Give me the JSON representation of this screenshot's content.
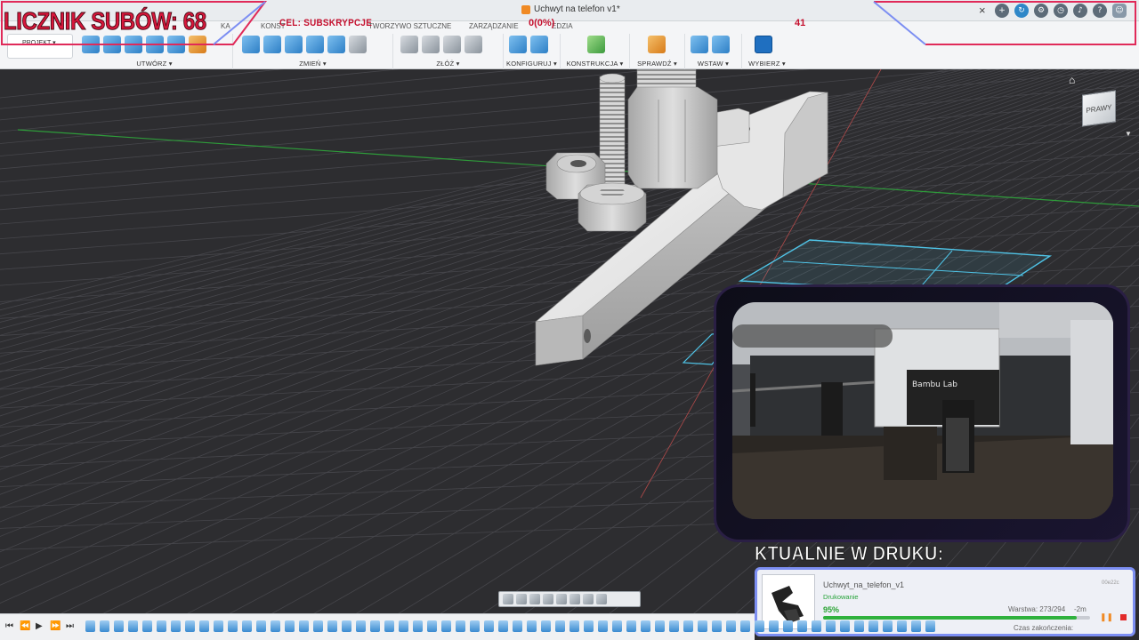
{
  "window": {
    "document_title": "Uchwyt na telefon v1*",
    "close_glyph": "×",
    "toolbar_icons": [
      "add-icon",
      "cloud-sync-icon",
      "extensions-icon",
      "clock-icon",
      "bell-icon",
      "help-icon",
      "user-avatar-icon"
    ]
  },
  "ribbon": {
    "projekt_label": "PROJEKT ▾",
    "tabs": [
      "KA",
      "KONST",
      "TWORZYWO SZTUCZNE",
      "ZARZĄDZANIE",
      "EDZIA"
    ],
    "groups": [
      {
        "label": "UTWÓRZ ▾"
      },
      {
        "label": "ZMIEŃ ▾"
      },
      {
        "label": "ZŁÓŻ ▾"
      },
      {
        "label": "KONFIGURUJ ▾"
      },
      {
        "label": "KONSTRUKCJA ▾"
      },
      {
        "label": "SPRAWDŹ ▾"
      },
      {
        "label": "WSTAW ▾"
      },
      {
        "label": "WYBIERZ ▾"
      }
    ]
  },
  "overlay": {
    "sub_counter": "LICZNIK SUBÓW: 68",
    "goal_label": "CEL: SUBSKRYPCJE",
    "goal_progress": "0(0%)",
    "goal_target": "41",
    "now_printing": "KTUALNIE W DRUKU:"
  },
  "viewcube": {
    "face_label": "PRAWY",
    "home_icon": "home-icon"
  },
  "webcam": {
    "printer_brand": "Bambu Lab"
  },
  "print_job": {
    "file_name": "Uchwyt_na_telefon_v1",
    "status": "Drukowanie",
    "percent_text": "95%",
    "percent_value": 0.95,
    "layer_text": "Warstwa: 273/294",
    "remaining_text": "-2m",
    "eta_label": "Czas zakończenia:",
    "job_id": "00e22c",
    "colors": {
      "progress": "#2fb13d",
      "status": "#27a33a",
      "pause": "#f08a24",
      "stop": "#e22a2a"
    }
  },
  "timeline": {
    "controls": [
      "⏮",
      "⏪",
      "▶",
      "⏩",
      "⏭"
    ],
    "feature_count": 60
  },
  "colors": {
    "overlay_red": "#d8163b",
    "overlay_frame_blue": "#7c8ef2",
    "viewport_bg": "#2b2b2d",
    "sketch_cyan": "#4fc3e6"
  }
}
